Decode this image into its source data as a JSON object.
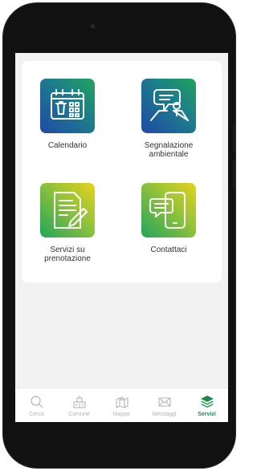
{
  "colors": {
    "active_tab": "#1f8a4c",
    "inactive_tab": "#b5b5b5",
    "icon_gradient_blue": "#1f4aa8",
    "icon_gradient_green": "#21a45a",
    "icon_gradient_yellow": "#e7d31e"
  },
  "services": [
    {
      "label": "Calendario",
      "icon": "calendar-trash-icon"
    },
    {
      "label": "Segnalazione\nambientale",
      "icon": "map-report-icon"
    },
    {
      "label": "Servizi su\nprenotazione",
      "icon": "document-edit-icon"
    },
    {
      "label": "Contattaci",
      "icon": "phone-chat-icon"
    }
  ],
  "tabbar": {
    "items": [
      {
        "label": "Cerca",
        "icon": "search-icon",
        "active": false
      },
      {
        "label": "Comune",
        "icon": "town-hall-icon",
        "active": false
      },
      {
        "label": "Mappe",
        "icon": "map-icon",
        "active": false
      },
      {
        "label": "Messaggi",
        "icon": "mail-icon",
        "active": false
      },
      {
        "label": "Servizi",
        "icon": "layers-icon",
        "active": true
      }
    ]
  }
}
